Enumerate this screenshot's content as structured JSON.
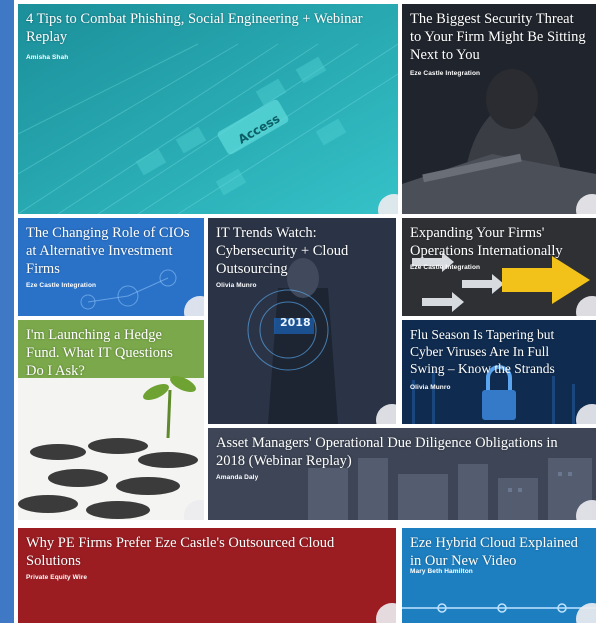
{
  "tiles": [
    {
      "title": "4 Tips to Combat Phishing, Social Engineering + Webinar Replay",
      "author": "Amisha Shah",
      "image_text": "Access"
    },
    {
      "title": "The Biggest Security Threat to Your Firm Might Be Sitting Next to You",
      "author": "Eze Castle Integration"
    },
    {
      "title": "The Changing Role of CIOs at Alternative Investment Firms",
      "author": "Eze Castle Integration"
    },
    {
      "title": "IT Trends Watch: Cybersecurity + Cloud Outsourcing",
      "author": "Olivia Munro",
      "image_text": "2018"
    },
    {
      "title": "Expanding Your Firms' Operations Internationally",
      "author": "Eze Castle Integration"
    },
    {
      "title": "I'm Launching a Hedge Fund. What IT Questions Do I Ask?",
      "author": ""
    },
    {
      "title": "Flu Season Is Tapering but Cyber Viruses Are In Full Swing – Know the Strands",
      "author": "Olivia Munro"
    },
    {
      "title": "Asset Managers' Operational Due Diligence Obligations in 2018 (Webinar Replay)",
      "author": "Amanda Daly"
    },
    {
      "title": "Why PE Firms Prefer Eze Castle's Outsourced Cloud Solutions",
      "author": "Private Equity Wire"
    },
    {
      "title": "Eze Hybrid Cloud Explained in Our New Video",
      "author": "Mary Beth Hamilton"
    }
  ],
  "colors": {
    "page_bg": "#3f78c4",
    "teal": "#1a9aa6",
    "navy": "#1c2230",
    "blue": "#2a72c8",
    "green": "#7aa84a",
    "red": "#9b1d22",
    "cloud_blue": "#1d7fc0"
  }
}
